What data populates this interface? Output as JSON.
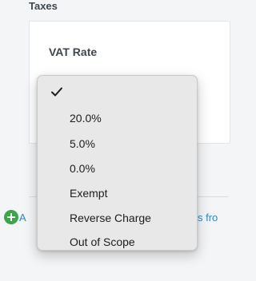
{
  "section": {
    "heading": "Taxes"
  },
  "vat": {
    "label": "VAT Rate"
  },
  "link": {
    "start": "A",
    "end": "s fro"
  },
  "dropdown": {
    "selected_index": 0,
    "options": [
      "",
      "20.0%",
      "5.0%",
      "0.0%",
      "Exempt",
      "Reverse Charge",
      "Out of Scope"
    ]
  }
}
